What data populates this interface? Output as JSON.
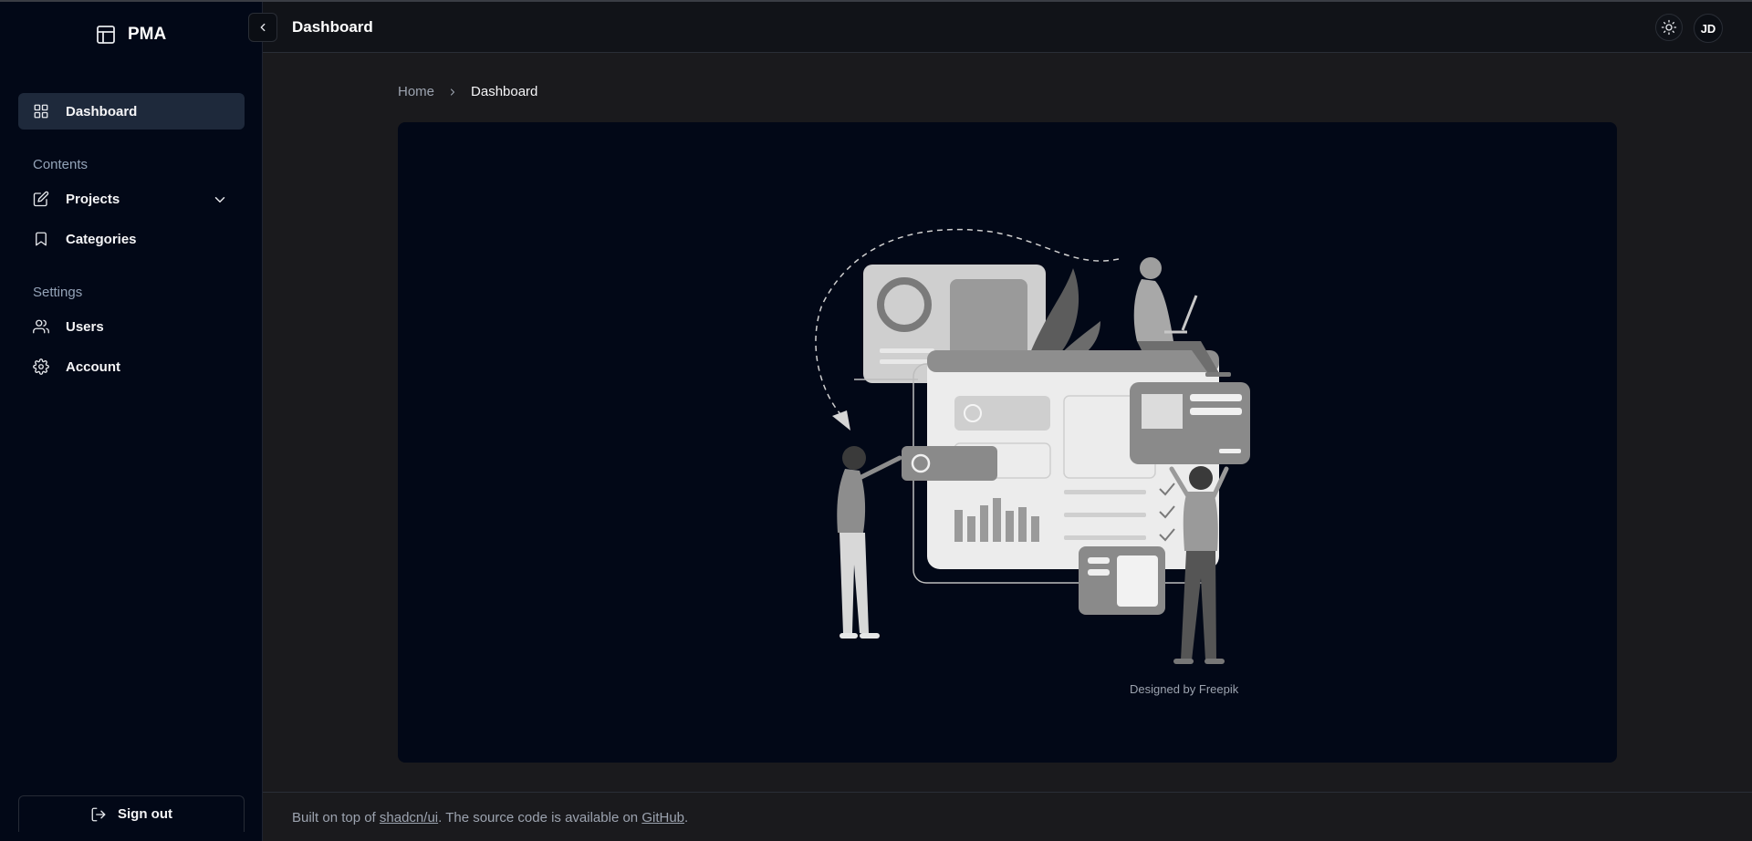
{
  "app": {
    "name": "PMA"
  },
  "header": {
    "title": "Dashboard",
    "avatar_initials": "JD"
  },
  "sidebar": {
    "items": [
      {
        "label": "Dashboard",
        "icon": "grid-icon",
        "active": true
      },
      {
        "label": "Projects",
        "icon": "edit-icon",
        "expandable": true
      },
      {
        "label": "Categories",
        "icon": "bookmark-icon"
      },
      {
        "label": "Users",
        "icon": "users-icon"
      },
      {
        "label": "Account",
        "icon": "settings-icon"
      }
    ],
    "groups": {
      "contents": "Contents",
      "settings": "Settings"
    },
    "signout_label": "Sign out"
  },
  "breadcrumb": {
    "home": "Home",
    "current": "Dashboard"
  },
  "main": {
    "credit": "Designed by Freepik"
  },
  "footer": {
    "prefix": "Built on top of ",
    "link1": "shadcn/ui",
    "middle": ". The source code is available on ",
    "link2": "GitHub",
    "suffix": "."
  },
  "colors": {
    "sidebar_bg": "#020817",
    "active_item_bg": "#1e293b",
    "panel_bg": "#020817",
    "page_bg": "#1a1a1d"
  }
}
